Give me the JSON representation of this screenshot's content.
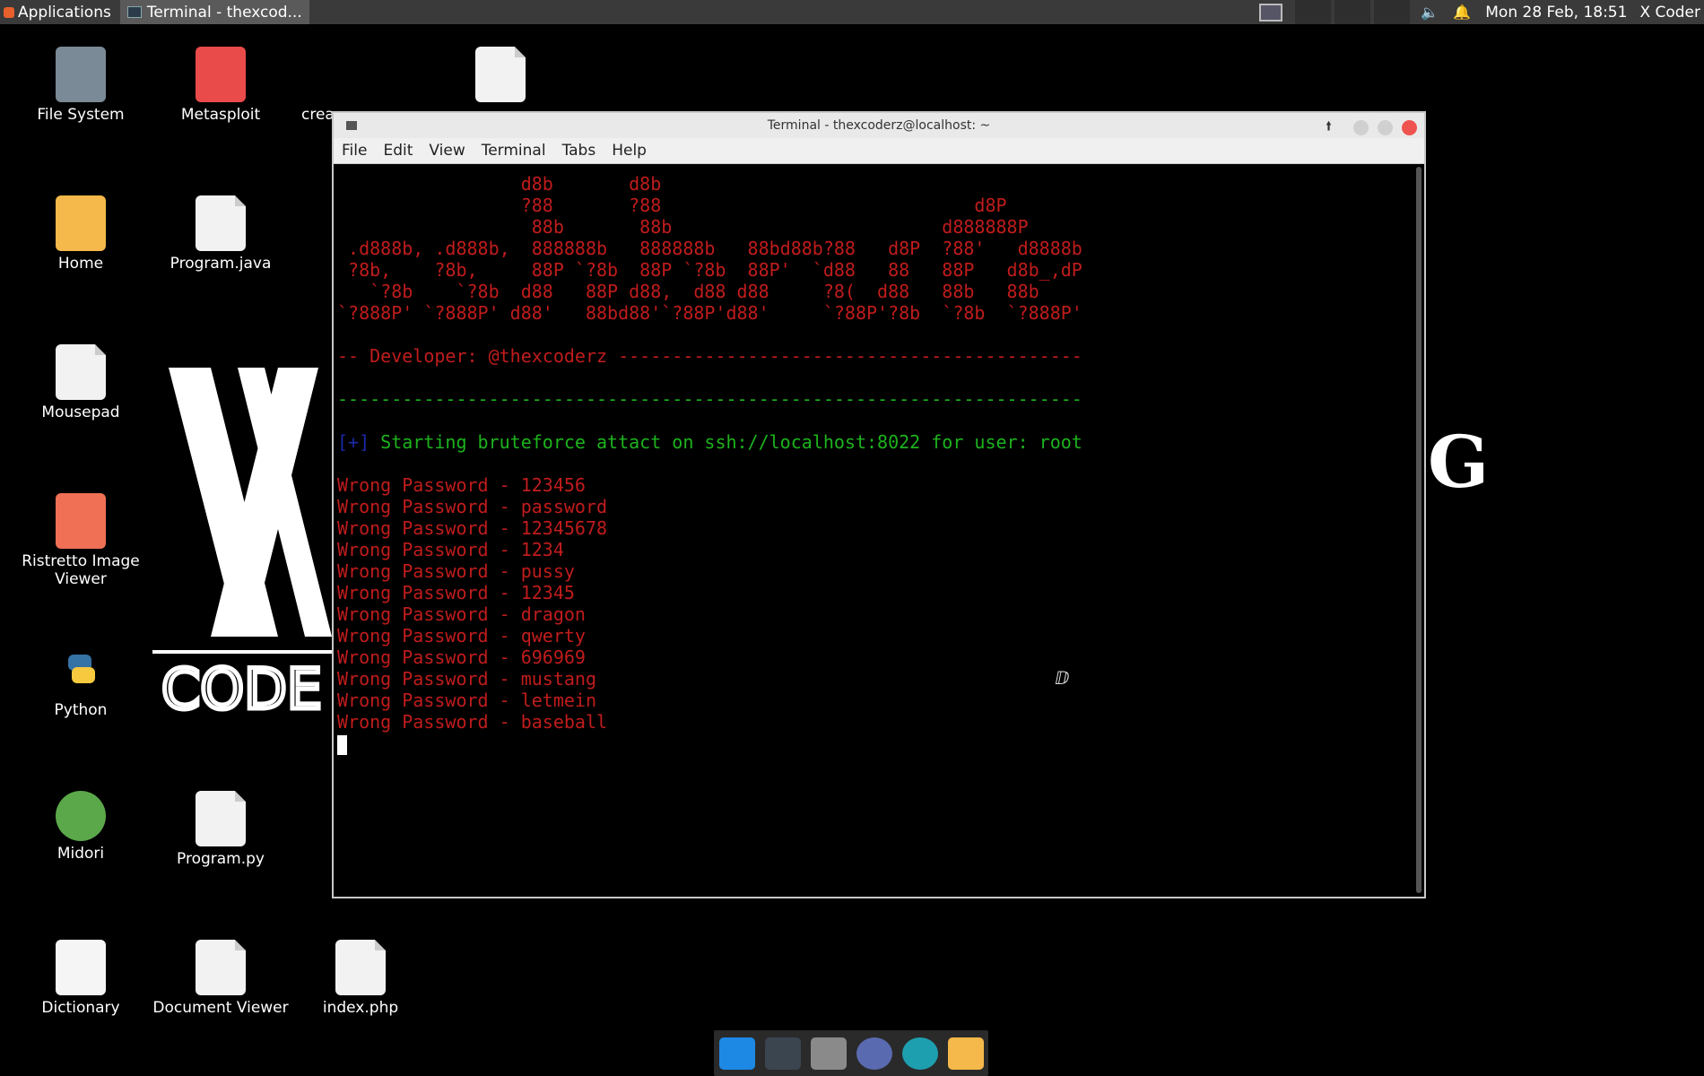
{
  "panel": {
    "applications_label": "Applications",
    "task_label": "Terminal - thexcod...",
    "clock": "Mon 28 Feb, 18:51",
    "user": "X Coder"
  },
  "desktop": {
    "icons": [
      {
        "label": "File System"
      },
      {
        "label": "Metasploit"
      },
      {
        "label": "crea"
      },
      {
        "label": "Home"
      },
      {
        "label": "Program.java"
      },
      {
        "label": "Mousepad"
      },
      {
        "label": "Ristretto Image Viewer"
      },
      {
        "label": "Python"
      },
      {
        "label": "Midori"
      },
      {
        "label": "Program.py"
      },
      {
        "label": "Dictionary"
      },
      {
        "label": "Document Viewer"
      },
      {
        "label": "index.php"
      }
    ],
    "background_logo_text": "CODE",
    "background_logo_right": "G"
  },
  "terminal": {
    "title": "Terminal - thexcoderz@localhost: ~",
    "menu": [
      "File",
      "Edit",
      "View",
      "Terminal",
      "Tabs",
      "Help"
    ],
    "banner": [
      "                 d8b       d8b",
      "                 ?88       ?88                             d8P",
      "                  88b       88b                         d888888P",
      " .d888b, .d888b,  888888b   888888b   88bd88b?88   d8P  ?88'   d8888b",
      " ?8b,    ?8b,     88P `?8b  88P `?8b  88P'  `d88   88   88P   d8b_,dP",
      "   `?8b    `?8b  d88   88P d88,  d88 d88     ?8(  d88   88b   88b",
      "`?888P' `?888P' d88'   88bd88'`?88P'd88'     `?88P'?8b  `?8b  `?888P'"
    ],
    "developer_line": "-- Developer: @thexcoderz -------------------------------------------",
    "separator": "---------------------------------------------------------------------",
    "status_prefix": "[+]",
    "status_text": " Starting bruteforce attact on ssh://localhost:8022 for user: root",
    "attempts": [
      "Wrong Password - 123456",
      "Wrong Password - password",
      "Wrong Password - 12345678",
      "Wrong Password - 1234",
      "Wrong Password - pussy",
      "Wrong Password - 12345",
      "Wrong Password - dragon",
      "Wrong Password - qwerty",
      "Wrong Password - 696969",
      "Wrong Password - mustang",
      "Wrong Password - letmein",
      "Wrong Password - baseball"
    ]
  },
  "colors": {
    "red": "#c01c1c",
    "green": "#1db31d",
    "blue": "#1a2aa8",
    "close": "#ef5350"
  }
}
